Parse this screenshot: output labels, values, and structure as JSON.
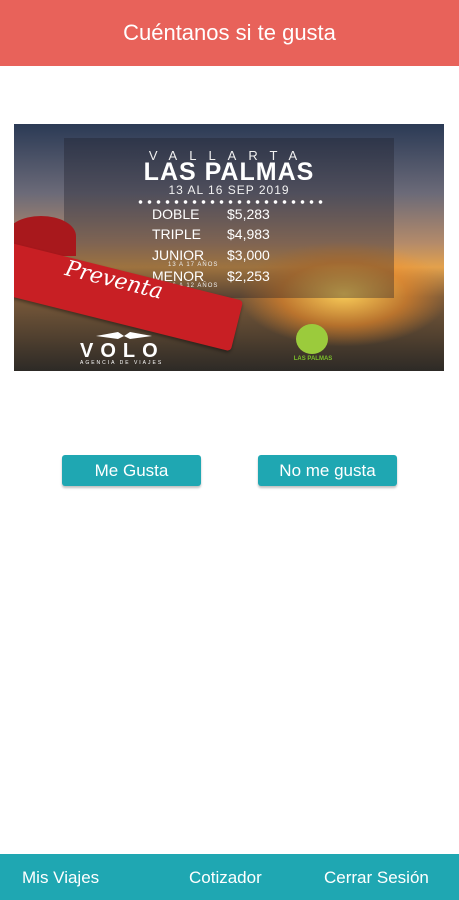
{
  "header": {
    "title": "Cuéntanos si te gusta"
  },
  "promo": {
    "destination_top": "VALLARTA",
    "destination_main": "LAS PALMAS",
    "dates": "13 AL 16 SEP 2019",
    "prices": [
      {
        "label": "DOBLE",
        "value": "$5,283",
        "note": ""
      },
      {
        "label": "TRIPLE",
        "value": "$4,983",
        "note": ""
      },
      {
        "label": "JUNIOR",
        "value": "$3,000",
        "note": "13 A 17 AÑOS"
      },
      {
        "label": "MENOR",
        "value": "$2,253",
        "note": "06 A 12 AÑOS"
      }
    ],
    "ribbon_text": "Preventa",
    "agency_name": "VOLO",
    "agency_tagline": "AGENCIA DE VIAJES",
    "hotel_logo_text": "LAS PALMAS",
    "ribbon_color": "#c81f24"
  },
  "actions": {
    "like_label": "Me Gusta",
    "dislike_label": "No me gusta"
  },
  "bottom_nav": {
    "items": [
      {
        "label": "Mis Viajes"
      },
      {
        "label": "Cotizador"
      },
      {
        "label": "Cerrar Sesión"
      }
    ]
  },
  "colors": {
    "header_bg": "#e8625a",
    "accent": "#1fa7b2"
  }
}
